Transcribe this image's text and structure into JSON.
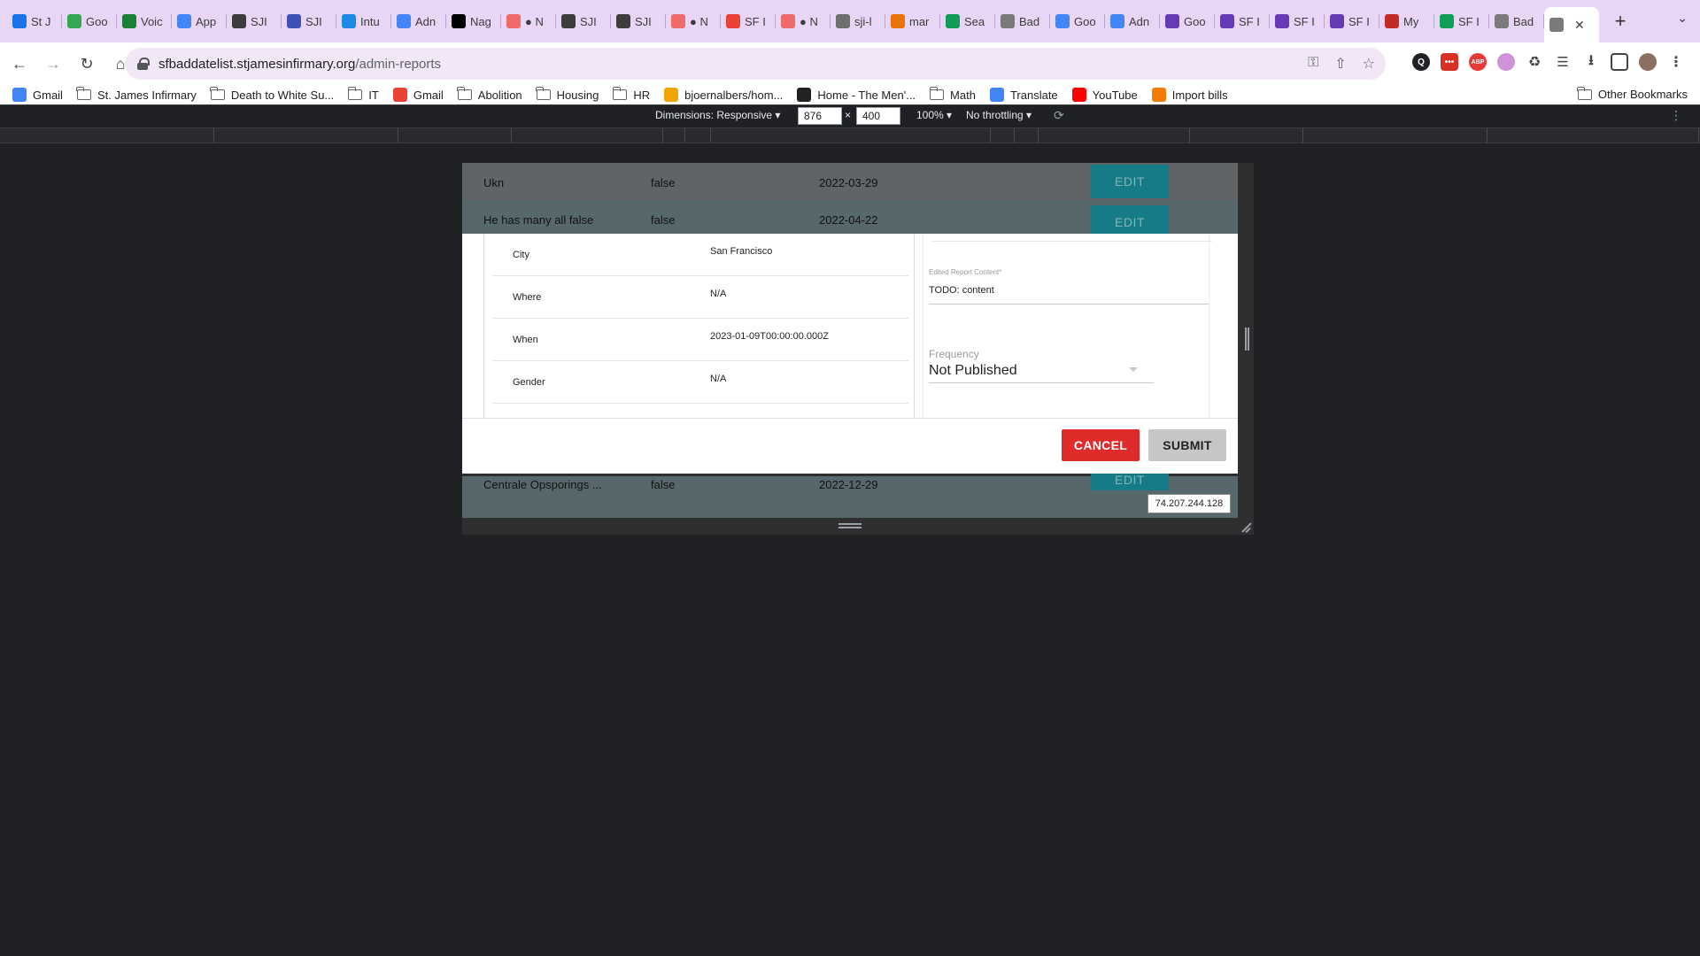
{
  "tabs": [
    {
      "label": "St J",
      "icon": "calendar-icon",
      "color": "#1a73e8"
    },
    {
      "label": "Goo",
      "icon": "photos-icon",
      "color": "#34a853"
    },
    {
      "label": "Voic",
      "icon": "voice-icon",
      "color": "#188038"
    },
    {
      "label": "App",
      "icon": "hex-icon",
      "color": "#4285f4"
    },
    {
      "label": "SJI",
      "icon": "sji-icon",
      "color": "#3c3c3c"
    },
    {
      "label": "SJI",
      "icon": "forms-icon",
      "color": "#3f51b5"
    },
    {
      "label": "Intu",
      "icon": "globe-icon",
      "color": "#1e88e5"
    },
    {
      "label": "Adn",
      "icon": "hex-icon",
      "color": "#4285f4"
    },
    {
      "label": "Nag",
      "icon": "notion-icon",
      "color": "#000000"
    },
    {
      "label": "● N",
      "icon": "asana-icon",
      "color": "#f06a6a"
    },
    {
      "label": "SJI",
      "icon": "sji-icon",
      "color": "#3c3c3c"
    },
    {
      "label": "SJI",
      "icon": "sji-icon",
      "color": "#3c3c3c"
    },
    {
      "label": "● N",
      "icon": "asana-icon",
      "color": "#f06a6a"
    },
    {
      "label": "SF I",
      "icon": "gmail-icon",
      "color": "#ea4335"
    },
    {
      "label": "● N",
      "icon": "asana-icon",
      "color": "#f06a6a"
    },
    {
      "label": "sji-l",
      "icon": "github-icon",
      "color": "#6e6e6e"
    },
    {
      "label": "mar",
      "icon": "dotted-icon",
      "color": "#e8710a"
    },
    {
      "label": "Sea",
      "icon": "drive-icon",
      "color": "#0f9d58"
    },
    {
      "label": "Bad",
      "icon": "globe-icon",
      "color": "#7a7a7a"
    },
    {
      "label": "Goo",
      "icon": "google-icon",
      "color": "#4285f4"
    },
    {
      "label": "Adn",
      "icon": "hex-icon",
      "color": "#4285f4"
    },
    {
      "label": "Goo",
      "icon": "forms-icon",
      "color": "#673ab7"
    },
    {
      "label": "SF I",
      "icon": "forms-icon",
      "color": "#673ab7"
    },
    {
      "label": "SF I",
      "icon": "forms-icon",
      "color": "#673ab7"
    },
    {
      "label": "SF I",
      "icon": "forms-icon",
      "color": "#673ab7"
    },
    {
      "label": "My",
      "icon": "stack-icon",
      "color": "#c62828"
    },
    {
      "label": "SF I",
      "icon": "sheets-icon",
      "color": "#0f9d58"
    },
    {
      "label": "Bad",
      "icon": "globe-icon",
      "color": "#7a7a7a"
    },
    {
      "label": "",
      "icon": "globe-icon",
      "color": "#7a7a7a",
      "active": true
    }
  ],
  "address": {
    "host": "sfbaddatelist.stjamesinfirmary.org",
    "path": "/admin-reports"
  },
  "bookmarks": [
    {
      "label": "Gmail",
      "icon": "google-icon",
      "color": "#4285f4"
    },
    {
      "label": "St. James Infirmary",
      "icon": "folder-icon"
    },
    {
      "label": "Death to White Su...",
      "icon": "folder-icon"
    },
    {
      "label": "IT",
      "icon": "folder-icon"
    },
    {
      "label": "Gmail",
      "icon": "gmail-icon",
      "color": "#ea4335"
    },
    {
      "label": "Abolition",
      "icon": "folder-icon"
    },
    {
      "label": "Housing",
      "icon": "folder-icon"
    },
    {
      "label": "HR",
      "icon": "folder-icon"
    },
    {
      "label": "bjoernalbers/hom...",
      "icon": "bolt-icon",
      "color": "#f0a500"
    },
    {
      "label": "Home - The Men'...",
      "icon": "film-icon",
      "color": "#222222"
    },
    {
      "label": "Math",
      "icon": "folder-icon"
    },
    {
      "label": "Translate",
      "icon": "translate-icon",
      "color": "#4285f4"
    },
    {
      "label": "YouTube",
      "icon": "youtube-icon",
      "color": "#ff0000"
    },
    {
      "label": "Import bills",
      "icon": "bill-icon",
      "color": "#f57c00"
    }
  ],
  "other_bookmarks": "Other Bookmarks",
  "devtools": {
    "dimensions": "Dimensions: Responsive ▾",
    "width": "876",
    "times": "×",
    "height": "400",
    "zoom": "100% ▾",
    "throttle": "No throttling ▾"
  },
  "table_rows": [
    {
      "name": "Ukn",
      "flag": "false",
      "date": "2022-03-29",
      "edit": "EDIT"
    },
    {
      "name": "He has many all false",
      "flag": "false",
      "date": "2022-04-22",
      "edit": "EDIT"
    },
    {
      "name": "Centrale Opsporings ...",
      "flag": "false",
      "date": "2022-12-29",
      "edit": "EDIT"
    }
  ],
  "modal": {
    "details": [
      {
        "key": "City",
        "value": "San Francisco"
      },
      {
        "key": "Where",
        "value": "N/A"
      },
      {
        "key": "When",
        "value": "2023-01-09T00:00:00.000Z"
      },
      {
        "key": "Gender",
        "value": "N/A"
      }
    ],
    "content_label": "Edited Report Content*",
    "content_value": "TODO: content",
    "frequency_label": "Frequency",
    "frequency_value": "Not Published",
    "cancel": "CANCEL",
    "submit": "SUBMIT"
  },
  "tooltip": "74.207.244.128",
  "colors": {
    "tab_bg": "#e9d5f5",
    "cancel": "#e02b2b",
    "edit": "#157b86"
  }
}
